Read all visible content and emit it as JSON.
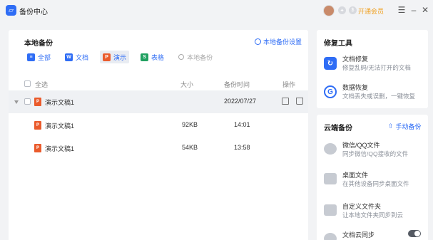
{
  "app": {
    "title": "备份中心"
  },
  "titlebar": {
    "vip_label": "开通会员"
  },
  "local": {
    "title": "本地备份",
    "settings_label": "本地备份设置",
    "filters": [
      {
        "label": "全部",
        "icon": "list-icon",
        "color": "#2f6df5"
      },
      {
        "label": "文档",
        "icon": "word-icon",
        "color": "#2f6df5"
      },
      {
        "label": "演示",
        "icon": "ppt-icon",
        "color": "#ea5b2c"
      },
      {
        "label": "表格",
        "icon": "sheet-icon",
        "color": "#20a060"
      }
    ],
    "search_placeholder": "本地备份",
    "columns": {
      "select_all": "全选",
      "size": "大小",
      "time": "备份时间",
      "action": "操作"
    },
    "group": {
      "name": "演示文稿1",
      "date": "2022/07/27"
    },
    "files": [
      {
        "name": "演示文稿1",
        "size": "92KB",
        "time": "14:01"
      },
      {
        "name": "演示文稿1",
        "size": "54KB",
        "time": "13:58"
      }
    ]
  },
  "repair": {
    "title": "修复工具",
    "tools": [
      {
        "name": "文档修复",
        "desc": "修复乱码/无法打开的文档",
        "color": "#2f6df5"
      },
      {
        "name": "数据恢复",
        "desc": "文档丢失或误删，一键恢复",
        "color": "#2f6df5"
      }
    ]
  },
  "cloud": {
    "title": "云端备份",
    "manual_label": "手动备份",
    "items": [
      {
        "name": "微信/QQ文件",
        "desc": "同步微信/QQ接收的文件"
      },
      {
        "name": "桌面文件",
        "desc": "在其他设备同步桌面文件"
      },
      {
        "name": "自定义文件夹",
        "desc": "让本地文件夹同步到云"
      },
      {
        "name": "文档云同步",
        "desc": ""
      }
    ]
  },
  "colors": {
    "accent": "#2f6df5",
    "vip": "#f0a020"
  }
}
